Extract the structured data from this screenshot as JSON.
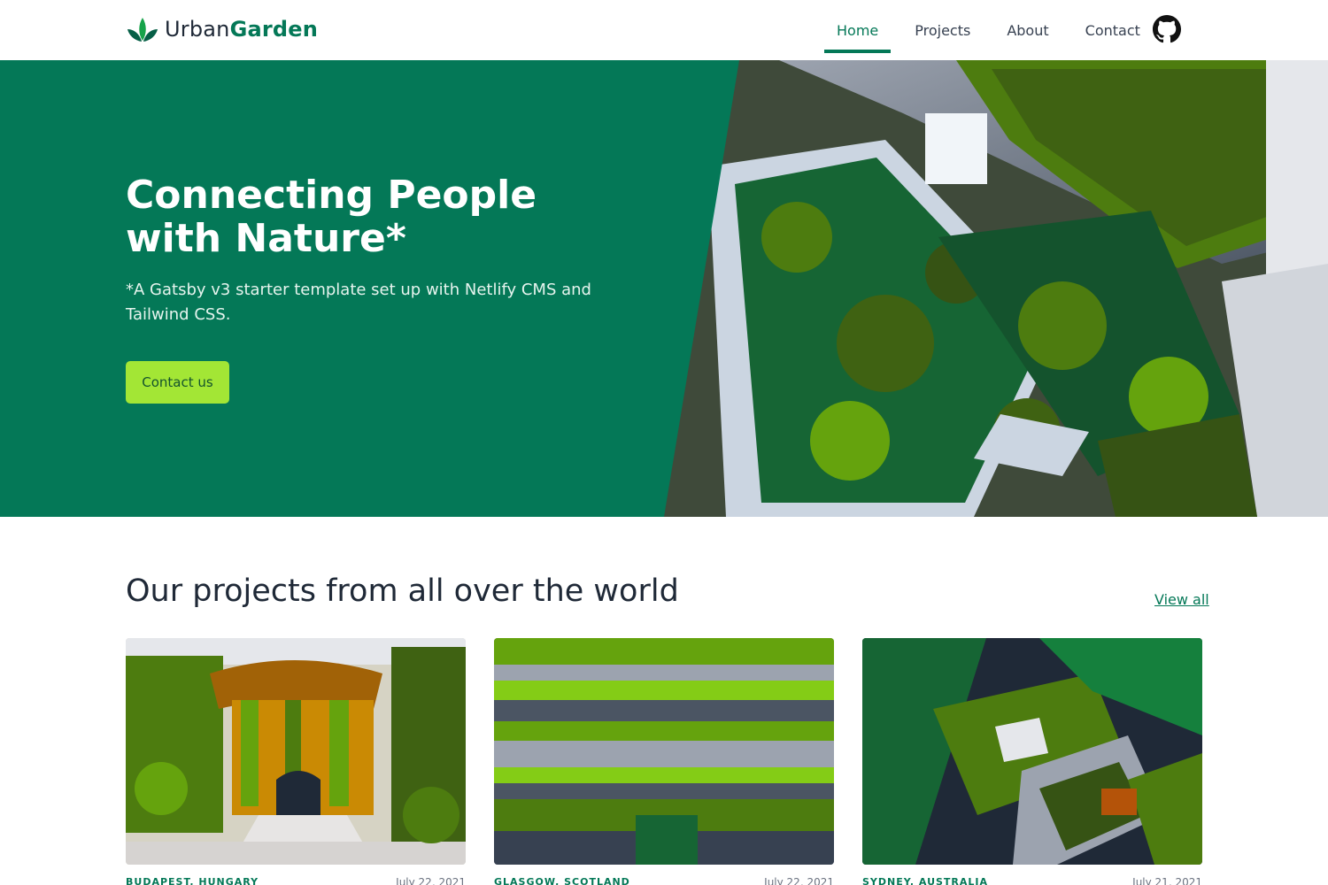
{
  "brand": {
    "name_part1": "Urban",
    "name_part2": "Garden",
    "logo_icon": "leaf-logo-icon",
    "accent": "#047857"
  },
  "nav": {
    "items": [
      {
        "label": "Home",
        "active": true
      },
      {
        "label": "Projects",
        "active": false
      },
      {
        "label": "About",
        "active": false
      },
      {
        "label": "Contact",
        "active": false
      }
    ],
    "github_icon": "github-icon"
  },
  "hero": {
    "title": "Connecting People with Nature*",
    "subtitle": "*A Gatsby v3 starter template set up with Netlify CMS and Tailwind CSS.",
    "cta_label": "Contact us",
    "bg_color": "#047857",
    "cta_color": "#a3e635"
  },
  "projects": {
    "heading": "Our projects from all over the world",
    "view_all_label": "View all",
    "cards": [
      {
        "location": "BUDAPEST, HUNGARY",
        "date": "July 22, 2021"
      },
      {
        "location": "GLASGOW, SCOTLAND",
        "date": "July 22, 2021"
      },
      {
        "location": "SYDNEY, AUSTRALIA",
        "date": "July 21, 2021"
      }
    ]
  }
}
